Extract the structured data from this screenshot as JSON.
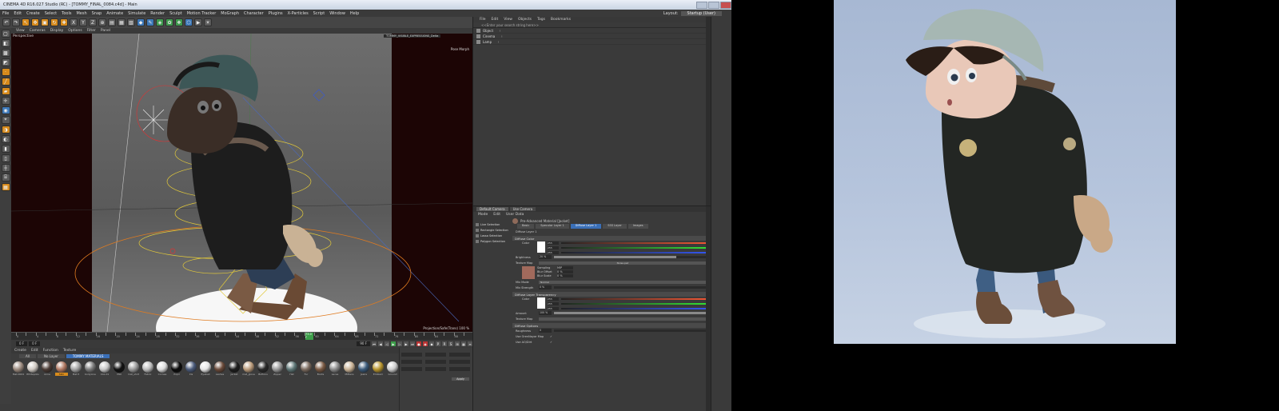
{
  "window": {
    "title": "CINEMA 4D R16.027 Studio (RC) - [TOMMY_FINAL_0084.c4d] - Main"
  },
  "menubar": {
    "items": [
      "File",
      "Edit",
      "Create",
      "Select",
      "Tools",
      "Mesh",
      "Snap",
      "Animate",
      "Simulate",
      "Render",
      "Sculpt",
      "Motion Tracker",
      "MoGraph",
      "Character",
      "Plugins",
      "X-Particles",
      "Script",
      "Window",
      "Help"
    ],
    "layout_label": "Layout:",
    "layout_value": "Startup (User)"
  },
  "toolbar": {
    "icons": [
      "undo-icon",
      "redo-icon",
      "live-select-icon",
      "move-icon",
      "scale-icon",
      "rotate-icon",
      "x-axis-icon",
      "y-axis-icon",
      "z-axis-icon",
      "world-coords-icon",
      "render-view-icon",
      "render-picture-icon",
      "render-settings-icon",
      "cube-icon",
      "pen-icon",
      "subdivision-icon",
      "array-icon",
      "scene-icon",
      "camera-icon",
      "light-icon"
    ]
  },
  "viewport": {
    "menu": [
      "View",
      "Cameras",
      "Display",
      "Options",
      "Filter",
      "Panel"
    ],
    "label": "Perspective",
    "status": "TOMMY_VISIBLE_EXPRESSIONS_Delta",
    "pose_label": "Pose Morph",
    "zoom_label": "Projection/Safe(Trans) 100 %"
  },
  "timeline": {
    "ticks": [
      "0",
      "2",
      "4",
      "6",
      "8",
      "10",
      "12",
      "14",
      "16",
      "18",
      "20",
      "22",
      "24",
      "26",
      "28",
      "30",
      "32",
      "34",
      "36",
      "38",
      "40",
      "42",
      "44",
      "46",
      "48",
      "50",
      "52",
      "54",
      "56",
      "58",
      "60",
      "62",
      "64",
      "66",
      "68",
      "70",
      "72",
      "74",
      "76",
      "78",
      "80",
      "82",
      "84",
      "86",
      "88",
      "90"
    ],
    "current": "73.0 F",
    "start": "0 F",
    "end": "90 F",
    "frame": "0 F"
  },
  "material_manager": {
    "menu": [
      "Create",
      "Edit",
      "Function",
      "Texture"
    ],
    "tabs": [
      "All",
      "No Layer",
      "TOMMY MATERIALS"
    ],
    "materials": [
      {
        "name": "Mat.0004",
        "color": "#9b8a7e"
      },
      {
        "name": "Whitepolish",
        "color": "#cfc9c2"
      },
      {
        "name": "Anna",
        "color": "#4a3a34"
      },
      {
        "name": "Skin",
        "color": "#b07862"
      },
      {
        "name": "Mat.5",
        "color": "#a4a4a4"
      },
      {
        "name": "bodyLine",
        "color": "#7a7a7a"
      },
      {
        "name": "CAL.01",
        "color": "#c8c8c8"
      },
      {
        "name": "Mat",
        "color": "#111111"
      },
      {
        "name": "mat_shirt",
        "color": "#9a9a9a"
      },
      {
        "name": "Fabric",
        "color": "#bdbdbd"
      },
      {
        "name": "Cornea",
        "color": "#dcdcdc"
      },
      {
        "name": "Pupil",
        "color": "#0a0a0a"
      },
      {
        "name": "Iris",
        "color": "#4a5a7a"
      },
      {
        "name": "Eyeball",
        "color": "#e6e6e6"
      },
      {
        "name": "Lashes",
        "color": "#6a4a3a"
      },
      {
        "name": "Jacket",
        "color": "#1d1d1d"
      },
      {
        "name": "mat_glove",
        "color": "#b99a7a"
      },
      {
        "name": "Buttons",
        "color": "#2a2a2a"
      },
      {
        "name": "Zipper",
        "color": "#9a9a9a"
      },
      {
        "name": "Hat",
        "color": "#5d7575"
      },
      {
        "name": "Fur",
        "color": "#7a6a5e"
      },
      {
        "name": "Boots",
        "color": "#7a5a44"
      },
      {
        "name": "Laces",
        "color": "#8a8a8a"
      },
      {
        "name": "Mittens",
        "color": "#c9b295"
      },
      {
        "name": "Jeans",
        "color": "#3a5a7a"
      },
      {
        "name": "Emblem",
        "color": "#b8952e"
      },
      {
        "name": "Ground",
        "color": "#cccccc"
      },
      {
        "name": "Skydome",
        "color": "#999999"
      },
      {
        "name": "Backdrop",
        "color": "#888888"
      }
    ]
  },
  "coords": {
    "apply_label": "Apply"
  },
  "object_manager": {
    "menu": [
      "File",
      "Edit",
      "View",
      "Objects",
      "Tags",
      "Bookmarks"
    ],
    "search_placeholder": "<<Enter your search string here>>",
    "objects": [
      "Object",
      "Cinema",
      "Lamp"
    ]
  },
  "attribute_manager": {
    "tabs": [
      "Default Camera",
      "Use Camera"
    ],
    "menu": [
      "Mode",
      "Edit",
      "User Data"
    ],
    "selections": [
      "Live Selection",
      "Rectangle Selection",
      "Lasso Selection",
      "Polygon Selection"
    ],
    "material_title": "Pre-Advanced Material [Jacket]",
    "subtabs": [
      "Basic",
      "Specular Layer 1",
      "Diffuse Layer 1",
      "SSS Layer",
      "Images"
    ],
    "layer_name": "Diffuse Layer 1",
    "sections": {
      "diffuse_color": "Diffuse Color",
      "transparency": "Diffuse Layer Transparency",
      "options": "Diffuse Options"
    },
    "props": {
      "color": "Color",
      "brightness": "Brightness",
      "brightness_val": "20 %",
      "texture_map": "Texture Map",
      "sampling": "Sampling",
      "sampling_val": "MIP",
      "blur_offset": "Blur Offset",
      "blur_offset_val": "0 %",
      "blur_scale": "Blur Scale",
      "blur_scale_val": "0 %",
      "mix_mode": "Mix Mode",
      "mix_mode_val": "Normal",
      "mix_strength": "Mix Strength",
      "mix_strength_val": "0 %",
      "amount": "Amount",
      "amount_val": "100 %",
      "roughness": "Roughness",
      "roughness_val": "0",
      "use_oren_nayar": "Use OrenNayar Map",
      "use_ao": "Use AO/Dirt",
      "noise_label": "Noise.psd",
      "rgb": [
        "255",
        "255",
        "255"
      ]
    }
  }
}
